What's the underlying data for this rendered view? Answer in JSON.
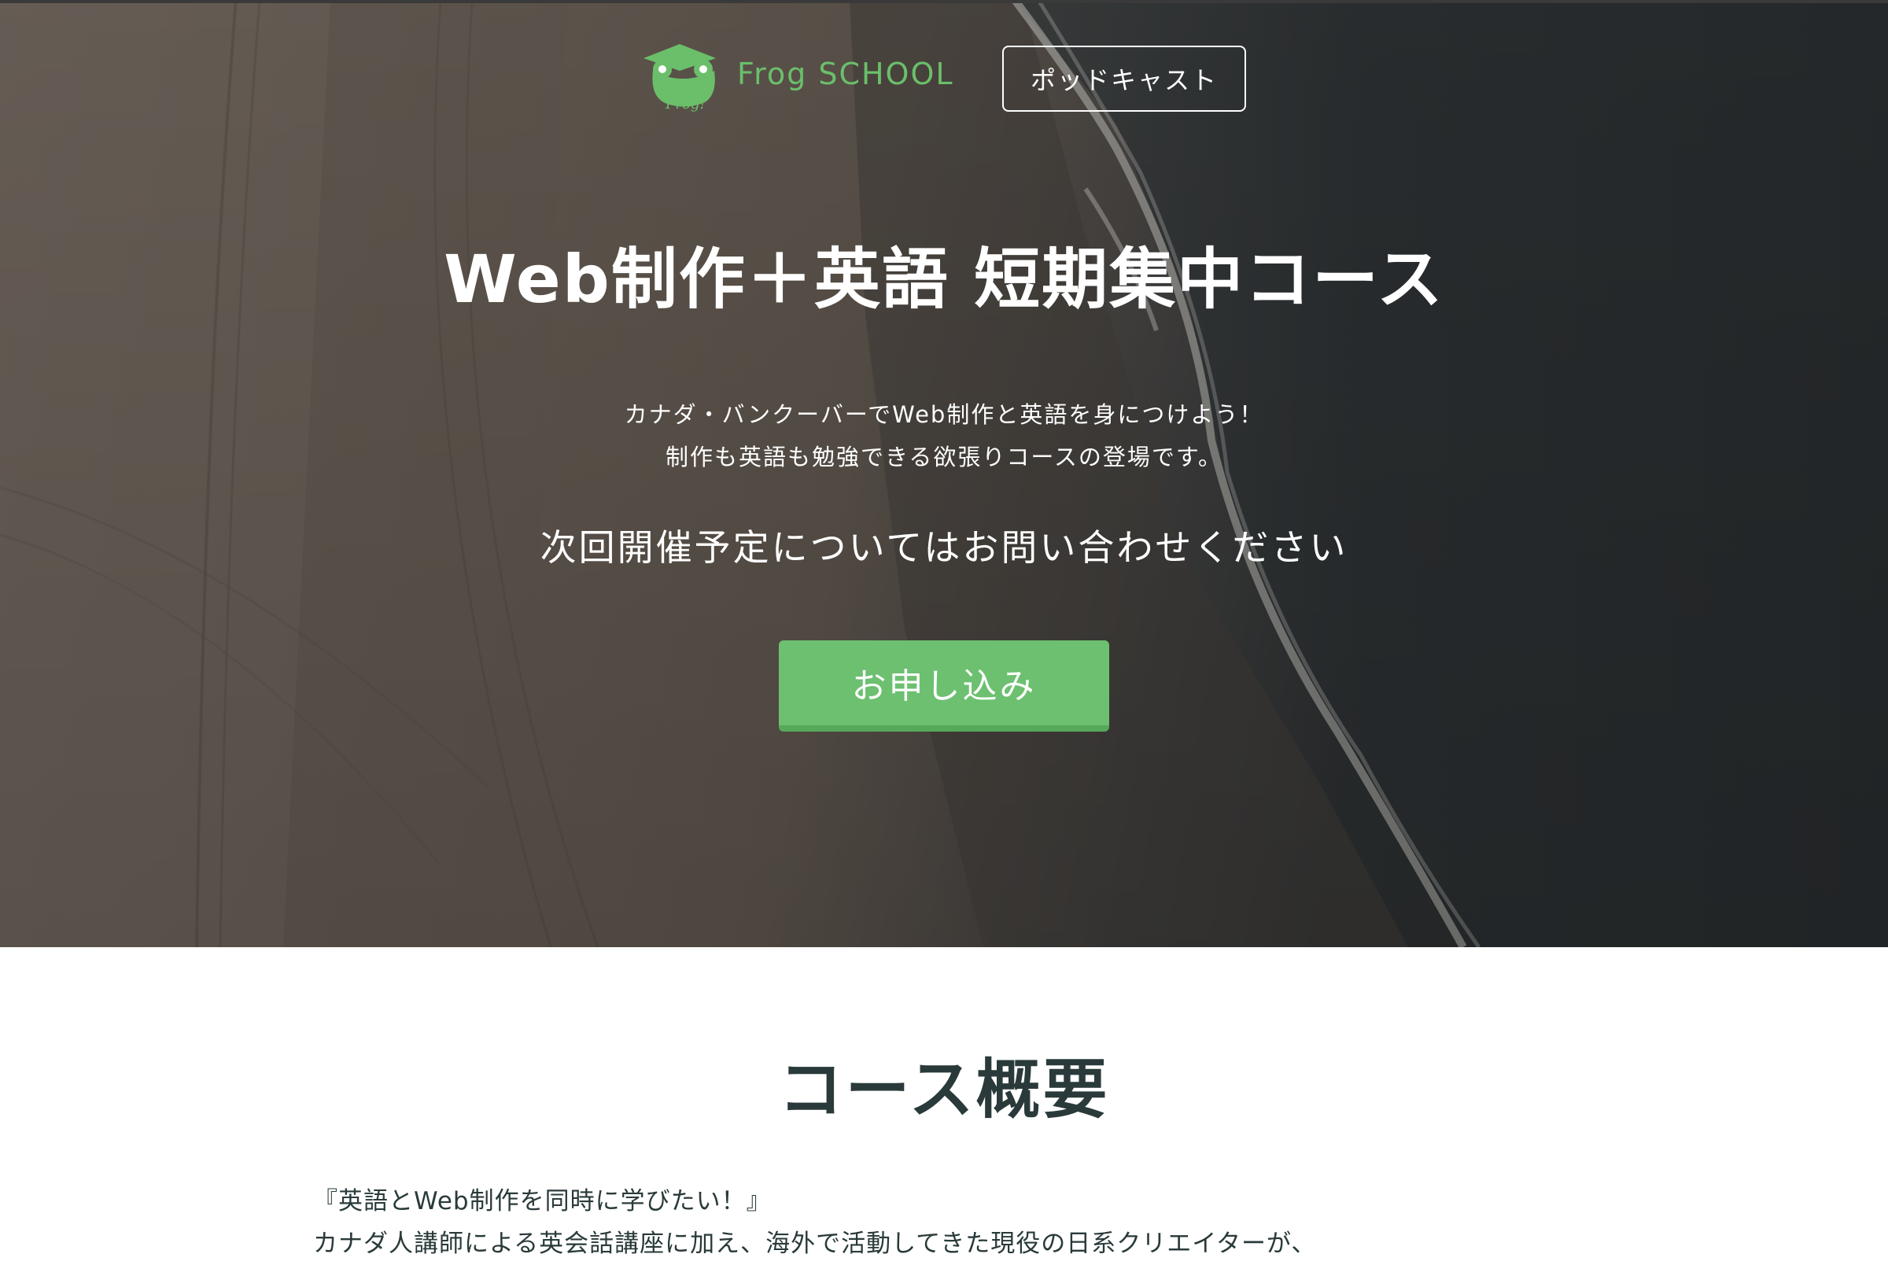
{
  "header": {
    "logo_text": "Frog SCHOOL",
    "logo_mark_text": "Frog!",
    "podcast_label": "ポッドキャスト"
  },
  "hero": {
    "title": "Web制作＋英語 短期集中コース",
    "description_line1": "カナダ・バンクーバーでWeb制作と英語を身につけよう！",
    "description_line2": "制作も英語も勉強できる欲張りコースの登場です。",
    "next_session": "次回開催予定についてはお問い合わせください",
    "apply_label": "お申し込み"
  },
  "overview": {
    "heading": "コース概要",
    "line1": "『英語とWeb制作を同時に学びたい！』",
    "line2": "カナダ人講師による英会話講座に加え、海外で活動してきた現役の日系クリエイターが、"
  },
  "colors": {
    "brand_green": "#6cc070",
    "logo_green": "#6bbf6a",
    "text_dark": "#2a3a3a"
  }
}
